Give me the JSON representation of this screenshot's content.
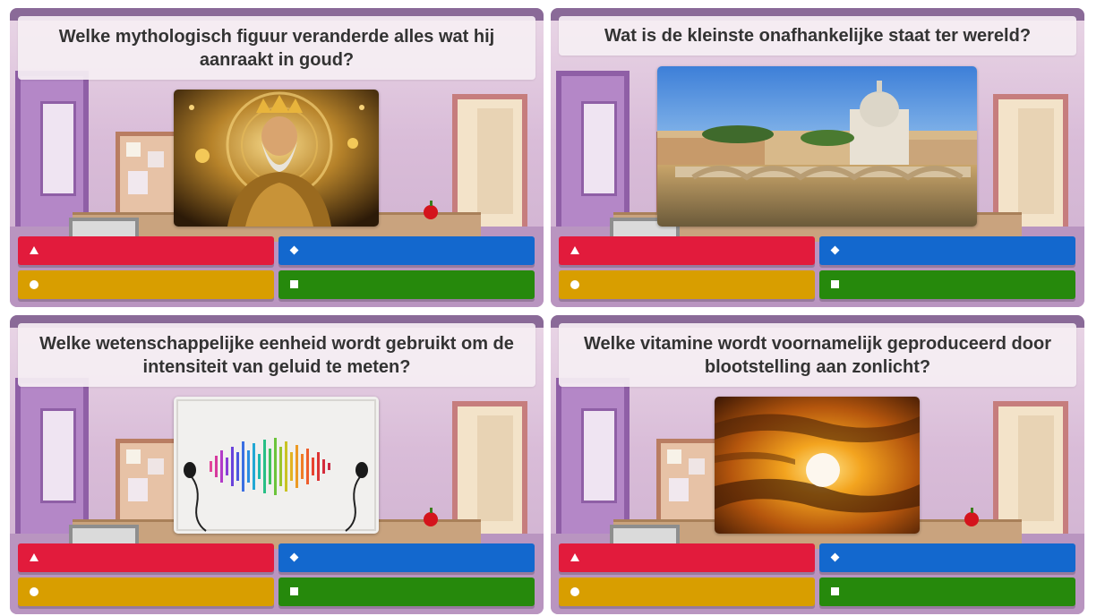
{
  "cards": [
    {
      "question": "Welke mythologisch figuur veranderde alles wat hij aanraakt in goud?",
      "image_icon": "golden-king-image",
      "answers": [
        {
          "color": "#e21b3c",
          "shape": "triangle-icon"
        },
        {
          "color": "#1368ce",
          "shape": "diamond-icon"
        },
        {
          "color": "#d89e00",
          "shape": "circle-icon"
        },
        {
          "color": "#26890c",
          "shape": "square-icon"
        }
      ]
    },
    {
      "question": "Wat is de kleinste onafhankelijke staat ter wereld?",
      "image_icon": "vatican-city-image",
      "answers": [
        {
          "color": "#e21b3c",
          "shape": "triangle-icon"
        },
        {
          "color": "#1368ce",
          "shape": "diamond-icon"
        },
        {
          "color": "#d89e00",
          "shape": "circle-icon"
        },
        {
          "color": "#26890c",
          "shape": "square-icon"
        }
      ]
    },
    {
      "question": "Welke wetenschappelijke eenheid wordt gebruikt om de intensiteit van geluid te meten?",
      "image_icon": "sound-wave-earphones-image",
      "answers": [
        {
          "color": "#e21b3c",
          "shape": "triangle-icon"
        },
        {
          "color": "#1368ce",
          "shape": "diamond-icon"
        },
        {
          "color": "#d89e00",
          "shape": "circle-icon"
        },
        {
          "color": "#26890c",
          "shape": "square-icon"
        }
      ]
    },
    {
      "question": "Welke vitamine wordt voornamelijk geproduceerd door blootstelling aan zonlicht?",
      "image_icon": "sunset-image",
      "answers": [
        {
          "color": "#e21b3c",
          "shape": "triangle-icon"
        },
        {
          "color": "#1368ce",
          "shape": "diamond-icon"
        },
        {
          "color": "#d89e00",
          "shape": "circle-icon"
        },
        {
          "color": "#26890c",
          "shape": "square-icon"
        }
      ]
    }
  ]
}
